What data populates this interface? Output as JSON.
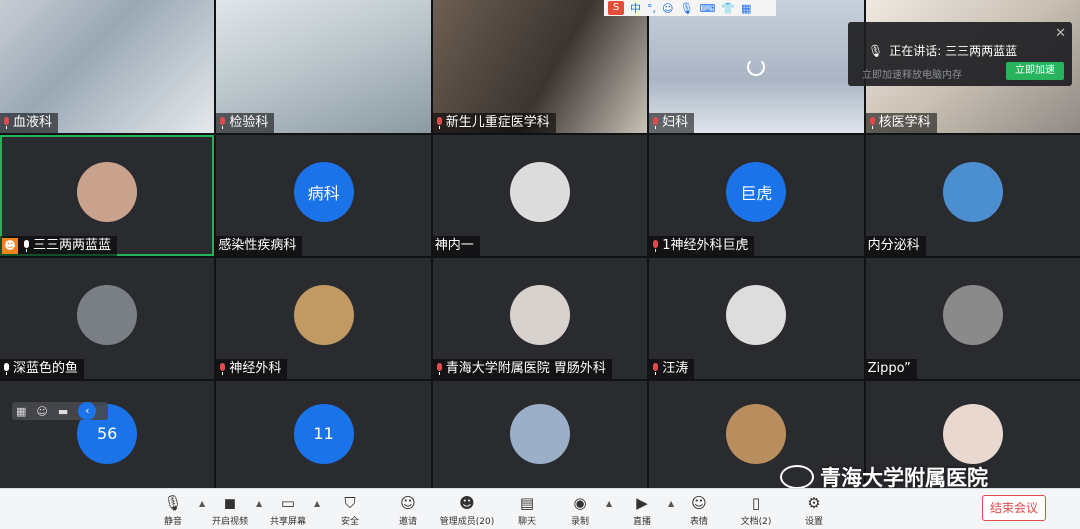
{
  "ime_bar": {
    "logo": "S",
    "mode": "中",
    "icons": [
      "punctuation-icon",
      "emoji-icon",
      "voice-icon",
      "keyboard-icon",
      "skin-icon",
      "toolbox-icon"
    ]
  },
  "speaking_popup": {
    "speaking_text": "正在讲话: 三三两两蓝蓝",
    "hint_text": "立即加速释放电脑内存",
    "action_label": "立即加速"
  },
  "participants": [
    {
      "name": "血液科",
      "type": "video",
      "mic": "off"
    },
    {
      "name": "检验科",
      "type": "video",
      "mic": "off"
    },
    {
      "name": "新生儿重症医学科",
      "type": "video",
      "mic": "off"
    },
    {
      "name": "妇科",
      "type": "video",
      "mic": "off",
      "loading": true
    },
    {
      "name": "核医学科",
      "type": "video",
      "mic": "off"
    },
    {
      "name": "三三两两蓝蓝",
      "type": "avatar-photo",
      "mic": "on",
      "host": true,
      "speaking": true
    },
    {
      "name": "感染性疾病科",
      "type": "avatar-text",
      "avatar_text": "病科"
    },
    {
      "name": "神内一",
      "type": "avatar-photo"
    },
    {
      "name": "1神经外科巨虎",
      "type": "avatar-text",
      "avatar_text": "巨虎",
      "mic": "off"
    },
    {
      "name": "内分泌科",
      "type": "avatar-photo"
    },
    {
      "name": "深蓝色的鱼",
      "type": "avatar-photo",
      "mic": "on"
    },
    {
      "name": "神经外科",
      "type": "avatar-photo",
      "mic": "off"
    },
    {
      "name": "青海大学附属医院 胃肠外科",
      "type": "avatar-photo",
      "mic": "off"
    },
    {
      "name": "汪涛",
      "type": "avatar-photo",
      "mic": "off"
    },
    {
      "name": "Zippo”",
      "type": "avatar-photo"
    },
    {
      "name": "",
      "type": "avatar-text",
      "avatar_text": "56"
    },
    {
      "name": "",
      "type": "avatar-text",
      "avatar_text": "11"
    },
    {
      "name": "",
      "type": "avatar-photo"
    },
    {
      "name": "",
      "type": "avatar-photo"
    },
    {
      "name": "",
      "type": "avatar-photo"
    }
  ],
  "toolbar": {
    "items": [
      {
        "label": "静音",
        "icon": "microphone-icon"
      },
      {
        "label": "开启视频",
        "icon": "video-off-icon"
      },
      {
        "label": "共享屏幕",
        "icon": "share-screen-icon"
      },
      {
        "label": "安全",
        "icon": "shield-icon"
      },
      {
        "label": "邀请",
        "icon": "invite-icon"
      },
      {
        "label": "管理成员(20)",
        "icon": "members-icon"
      },
      {
        "label": "聊天",
        "icon": "chat-icon"
      },
      {
        "label": "录制",
        "icon": "record-icon"
      },
      {
        "label": "直播",
        "icon": "live-icon"
      },
      {
        "label": "表情",
        "icon": "emoji-icon"
      },
      {
        "label": "文档(2)",
        "icon": "document-icon"
      },
      {
        "label": "设置",
        "icon": "gear-icon"
      }
    ],
    "end_label": "结束会议"
  },
  "watermark": {
    "text": "青海大学附属医院"
  },
  "colors": {
    "accent": "#1a73e8",
    "speaking_border": "#23b15a",
    "end_red": "#e34b4b",
    "host_orange": "#f2841d"
  }
}
